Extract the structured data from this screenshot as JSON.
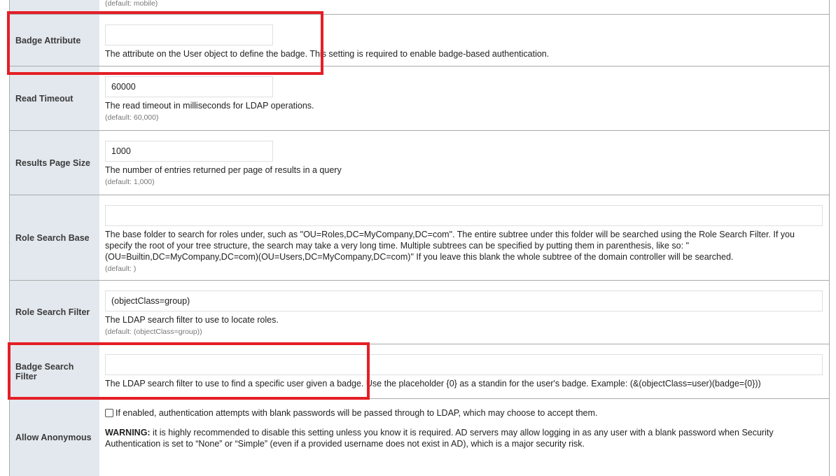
{
  "top_row": {
    "default": "(default: mobile)"
  },
  "rows": [
    {
      "label": "Badge Attribute",
      "value": "",
      "description": "The attribute on the User object to define the badge. This setting is required to enable badge-based authentication."
    },
    {
      "label": "Read Timeout",
      "value": "60000",
      "description": "The read timeout in milliseconds for LDAP operations.",
      "default": "(default: 60,000)"
    },
    {
      "label": "Results Page Size",
      "value": "1000",
      "description": "The number of entries returned per page of results in a query",
      "default": "(default: 1,000)"
    },
    {
      "label": "Role Search Base",
      "value": "",
      "description": "The base folder to search for roles under, such as \"OU=Roles,DC=MyCompany,DC=com\". The entire subtree under this folder will be searched using the Role Search Filter. If you specify the root of your tree structure, the search may take a very long time. Multiple subtrees can be specified by putting them in parenthesis, like so: \"(OU=Builtin,DC=MyCompany,DC=com)(OU=Users,DC=MyCompany,DC=com)\" If you leave this blank the whole subtree of the domain controller will be searched.",
      "default": "(default: )"
    },
    {
      "label": "Role Search Filter",
      "value": "(objectClass=group)",
      "description": "The LDAP search filter to use to locate roles.",
      "default": "(default: (objectClass=group))"
    },
    {
      "label": "Badge Search Filter",
      "value": "",
      "description": "The LDAP search filter to use to find a specific user given a badge. Use the placeholder {0} as a standin for the user's badge. Example: (&(objectClass=user)(badge={0}))"
    },
    {
      "label": "Allow Anonymous",
      "checked": false,
      "checkbox_label": "If enabled, authentication attempts with blank passwords will be passed through to LDAP, which may choose to accept them.",
      "warning_label": "WARNING:",
      "warning_text": " it is highly recommended to disable this setting unless you know it is required. AD servers may allow logging in as any user with a blank password when Security Authentication is set to “None” or “Simple” (even if a provided username does not exist in AD), which is a major security risk."
    }
  ],
  "highlight_color": "#e41e26"
}
